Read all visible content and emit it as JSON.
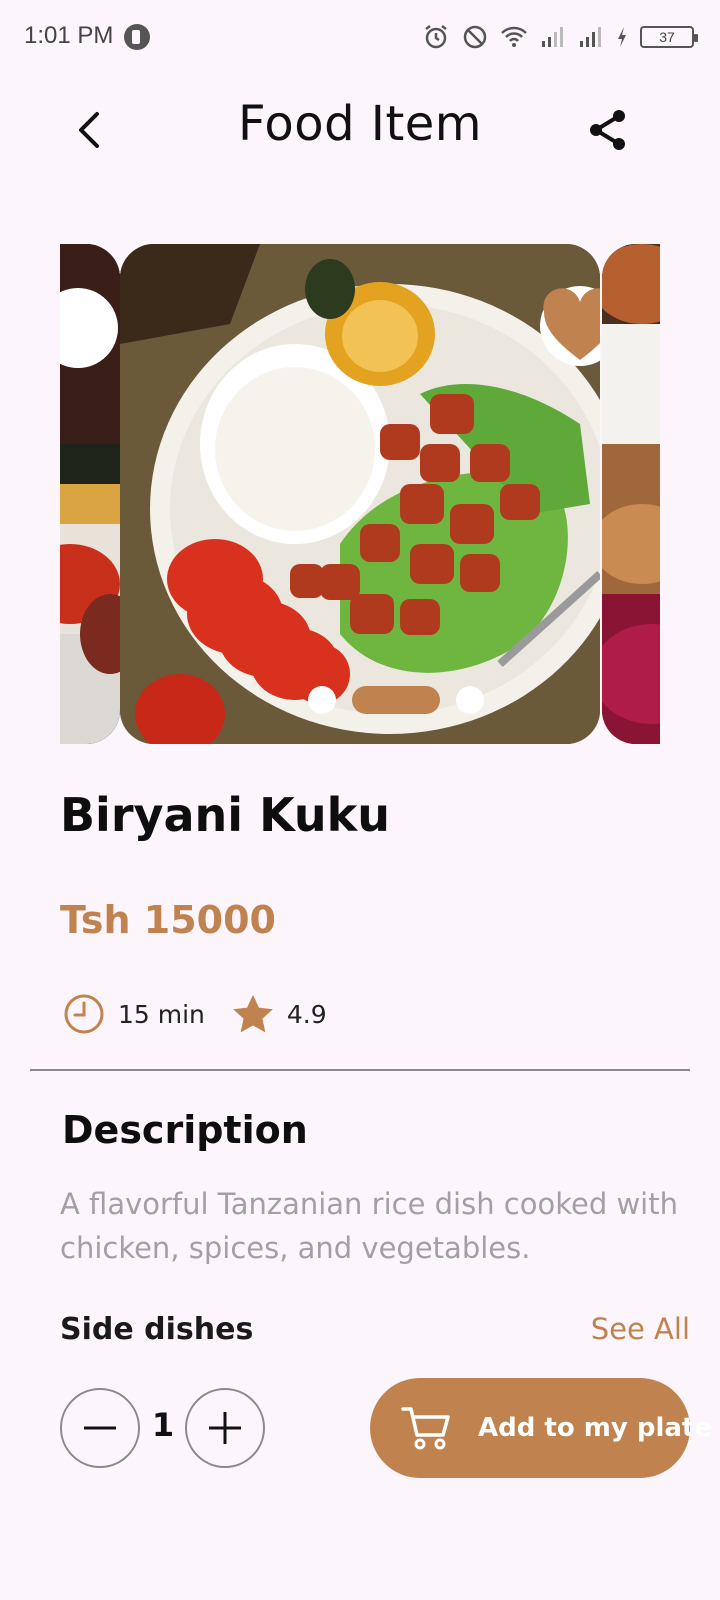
{
  "status_bar": {
    "time": "1:01 PM",
    "battery": "37"
  },
  "header": {
    "title": "Food Item"
  },
  "food": {
    "name": "Biryani Kuku",
    "price": "Tsh 15000",
    "time": "15 min",
    "rating": "4.9",
    "description_title": "Description",
    "description": "A flavorful Tanzanian rice dish cooked with chicken, spices, and vegetables."
  },
  "side_dishes": {
    "title": "Side dishes",
    "see_all": "See All"
  },
  "order": {
    "quantity": "1",
    "add_label": "Add to my plate"
  },
  "carousel": {
    "slide_count": 3,
    "active_index": 1
  },
  "icons": {
    "back": "chevron-left-icon",
    "share": "share-icon",
    "favorite": "heart-icon",
    "time": "clock-icon",
    "rating": "star-icon",
    "minus": "minus-icon",
    "plus": "plus-icon",
    "cart": "cart-icon"
  },
  "colors": {
    "accent": "#c0834f",
    "background": "#fdf5fc",
    "muted_text": "#a3a0a3"
  }
}
